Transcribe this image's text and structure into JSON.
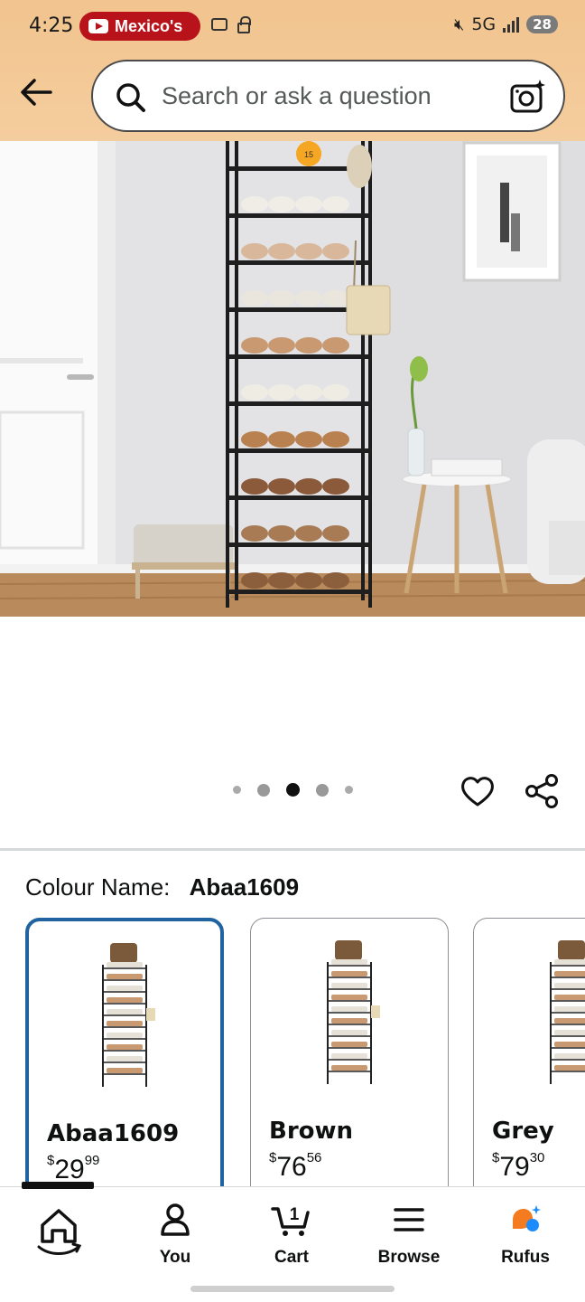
{
  "status_bar": {
    "time": "4:25",
    "notification": "Mexico's",
    "network": "5G",
    "battery": "28"
  },
  "header": {
    "search_placeholder": "Search or ask a question"
  },
  "gallery": {
    "dots_count": 5,
    "active_index": 2,
    "ball_number": "15"
  },
  "variant": {
    "label": "Colour Name:",
    "selected": "Abaa1609",
    "options": [
      {
        "name": "Abaa1609",
        "price_symbol": "$",
        "price_whole": "29",
        "price_fraction": "99"
      },
      {
        "name": "Brown",
        "price_symbol": "$",
        "price_whole": "76",
        "price_fraction": "56"
      },
      {
        "name": "Grey",
        "price_symbol": "$",
        "price_whole": "79",
        "price_fraction": "30"
      }
    ]
  },
  "bottom_nav": {
    "items": [
      {
        "label": "",
        "icon": "home-icon"
      },
      {
        "label": "You",
        "icon": "user-icon"
      },
      {
        "label": "Cart",
        "icon": "cart-icon",
        "badge": "1"
      },
      {
        "label": "Browse",
        "icon": "menu-icon"
      },
      {
        "label": "Rufus",
        "icon": "rufus-icon"
      }
    ]
  },
  "colors": {
    "header_bg": "#f2c48e",
    "selected_border": "#2162a1",
    "rufus_orange": "#f47b20",
    "rufus_blue": "#1a8cff"
  }
}
